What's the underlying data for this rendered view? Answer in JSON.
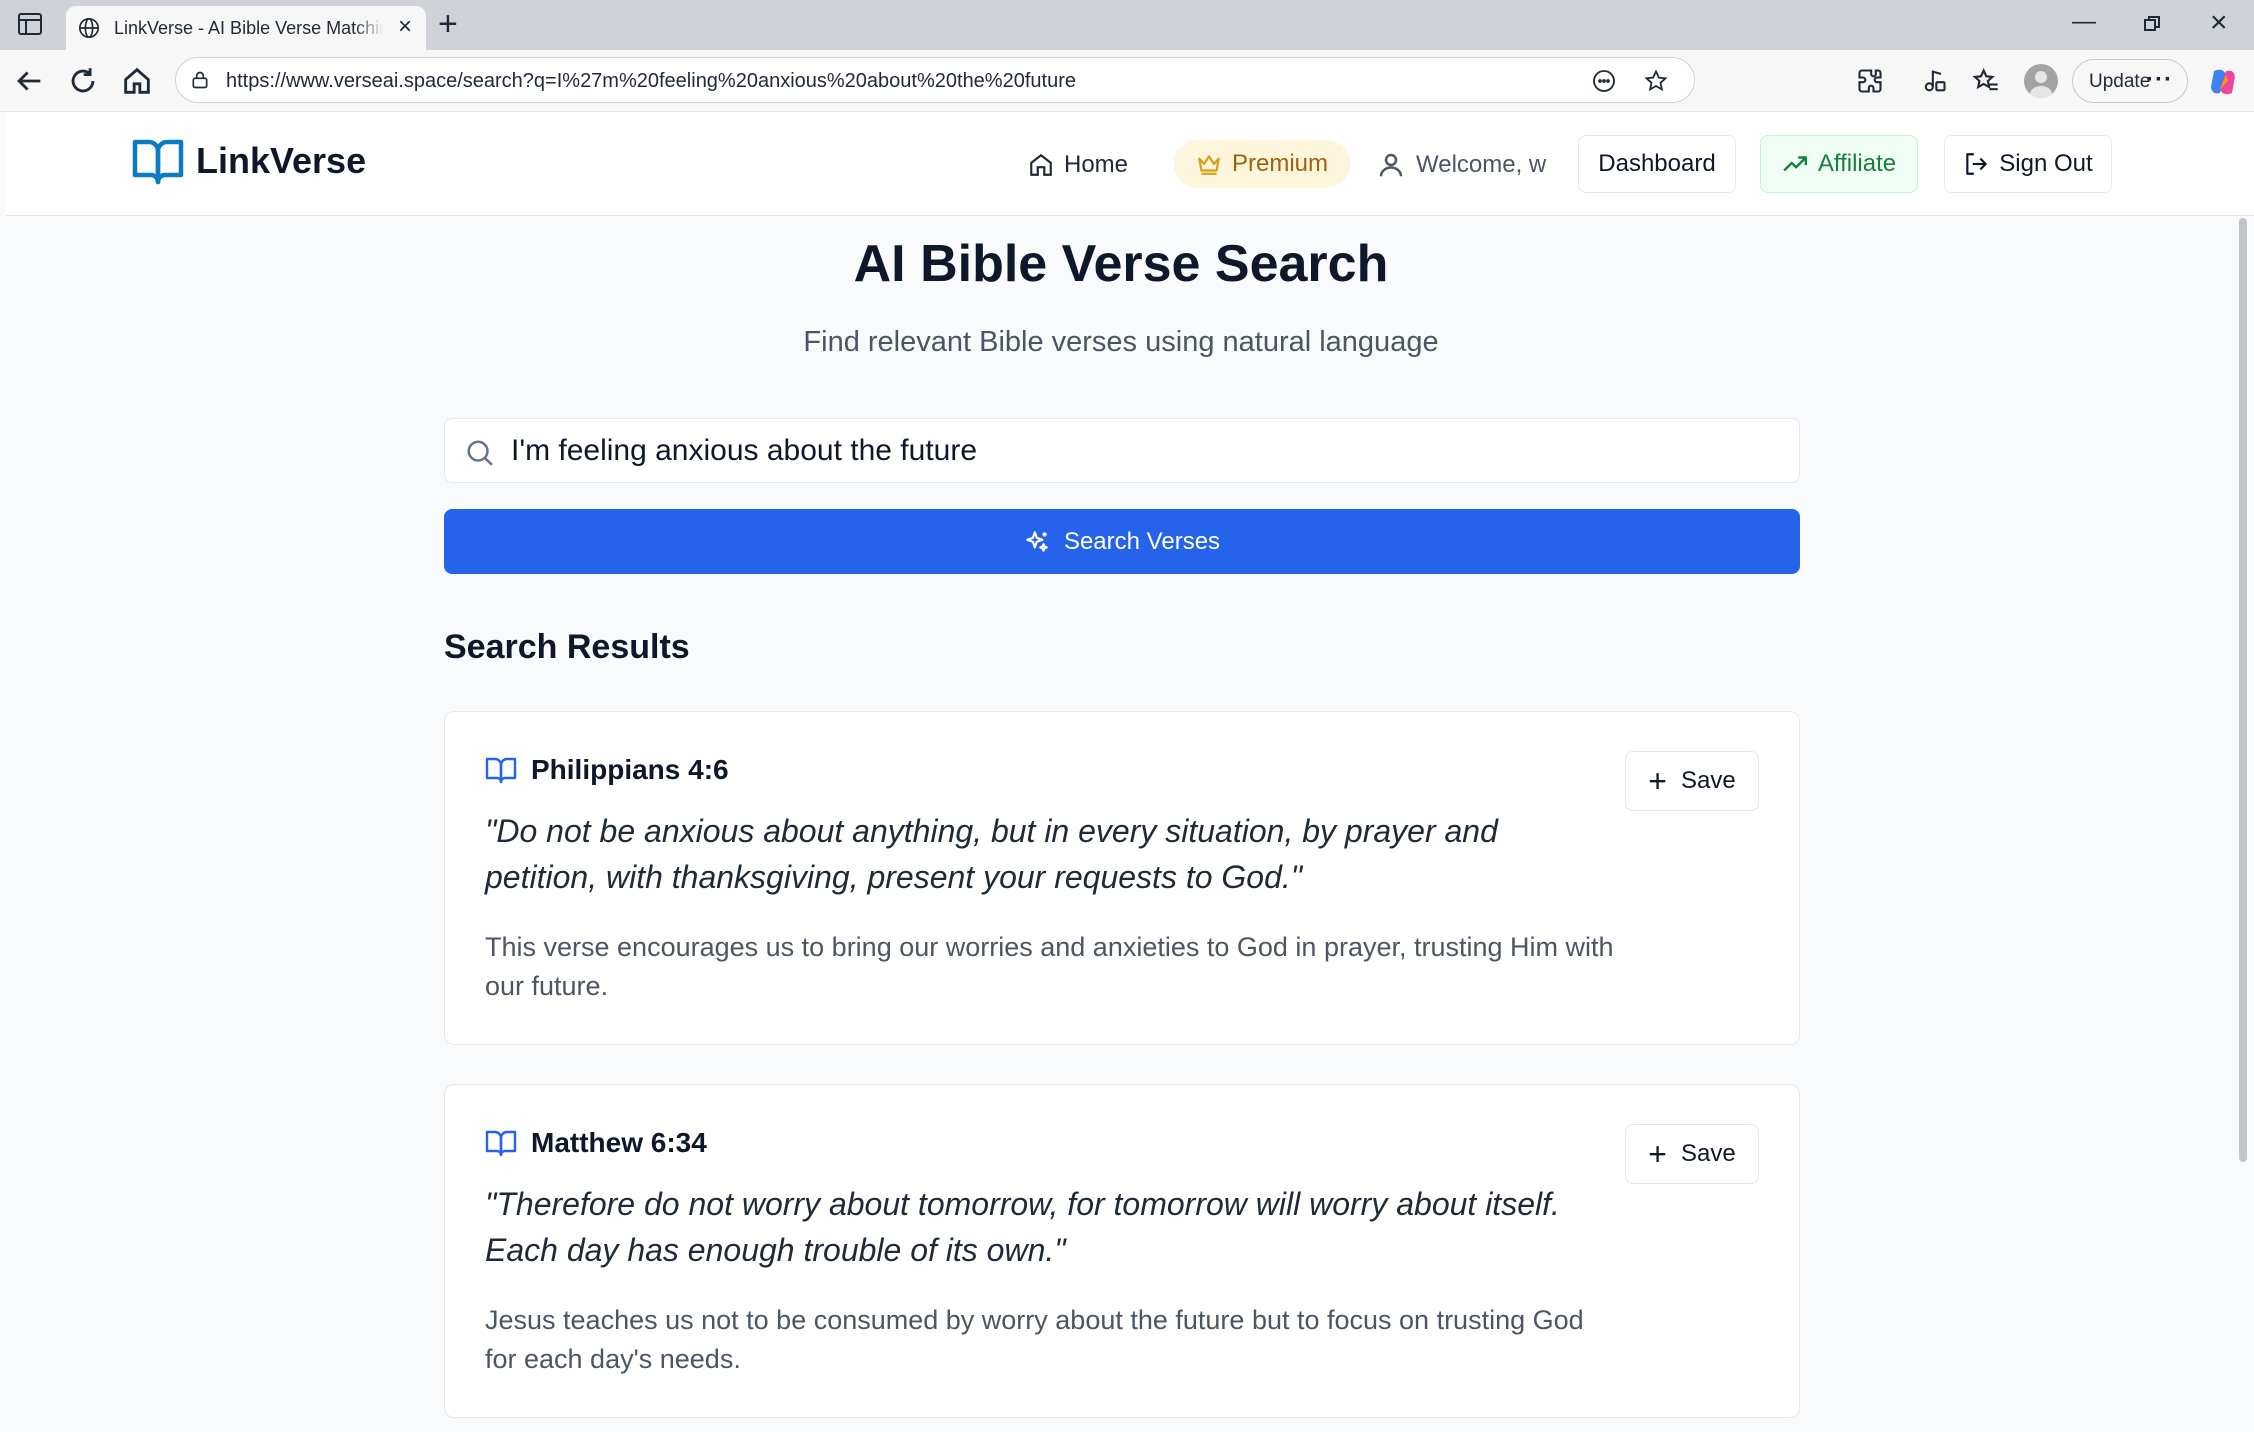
{
  "browser": {
    "tab_title": "LinkVerse - AI Bible Verse Matching",
    "url": "https://www.verseai.space/search?q=I%27m%20feeling%20anxious%20about%20the%20future",
    "update_label": "Update"
  },
  "header": {
    "brand": "LinkVerse",
    "nav": {
      "home": "Home",
      "premium": "Premium",
      "welcome": "Welcome, w",
      "dashboard": "Dashboard",
      "affiliate": "Affiliate",
      "sign_out": "Sign Out"
    }
  },
  "main": {
    "title": "AI Bible Verse Search",
    "subtitle": "Find relevant Bible verses using natural language",
    "search": {
      "value": "I'm feeling anxious about the future",
      "button_label": "Search Verses"
    },
    "results_heading": "Search Results",
    "results": [
      {
        "reference": "Philippians 4:6",
        "verse": "\"Do not be anxious about anything, but in every situation, by prayer and petition, with thanksgiving, present your requests to God.\"",
        "explanation": "This verse encourages us to bring our worries and anxieties to God in prayer, trusting Him with our future.",
        "save_label": "Save"
      },
      {
        "reference": "Matthew 6:34",
        "verse": "\"Therefore do not worry about tomorrow, for tomorrow will worry about itself. Each day has enough trouble of its own.\"",
        "explanation": "Jesus teaches us not to be consumed by worry about the future but to focus on trusting God for each day's needs.",
        "save_label": "Save"
      }
    ]
  },
  "colors": {
    "primary": "#2563eb",
    "premium_bg": "#fdf6dd",
    "premium_text": "#a16207",
    "affiliate_bg": "#f0fdf4",
    "affiliate_text": "#15803d",
    "logo_blue": "#0b7bc4"
  }
}
